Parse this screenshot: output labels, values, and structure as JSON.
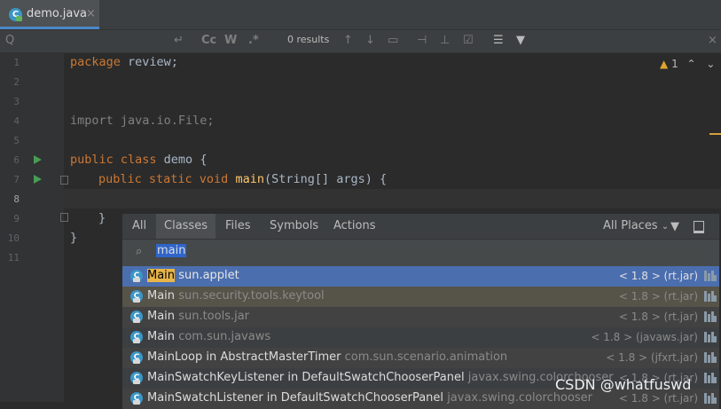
{
  "tab": {
    "title": "demo.java",
    "icon_letter": "C",
    "close": "×"
  },
  "searchbar": {
    "search_icon": "Q",
    "replace_icon": "↵",
    "match_case": "Cc",
    "words": "W",
    "regex": ".*",
    "results": "0 results",
    "close": "×"
  },
  "editor": {
    "line_numbers": [
      "1",
      "2",
      "3",
      "4",
      "5",
      "6",
      "7",
      "8",
      "9",
      "10",
      "11"
    ],
    "lines": {
      "l1_kw": "package",
      "l1_rest": " review;",
      "l4": "import java.io.File;",
      "l6_kw": "public class",
      "l6_rest": " demo {",
      "l7_kw": "public static void",
      "l7_name": " main",
      "l7_rest": "(String[] args) {",
      "l9": "}",
      "l10": "}"
    },
    "warning_count": "1",
    "warning_icon": "▲",
    "nav_up": "⌃",
    "nav_down": "⌄"
  },
  "popup": {
    "tabs": [
      "All",
      "Classes",
      "Files",
      "Symbols",
      "Actions"
    ],
    "selected_tab": "Classes",
    "all_places": "All Places",
    "query": "main",
    "results": [
      {
        "name": "Main",
        "package": "sun.applet",
        "location": "< 1.8 > (rt.jar)"
      },
      {
        "name": "Main",
        "package": "sun.security.tools.keytool",
        "location": "< 1.8 > (rt.jar)"
      },
      {
        "name": "Main",
        "package": "sun.tools.jar",
        "location": "< 1.8 > (rt.jar)"
      },
      {
        "name": "Main",
        "package": "com.sun.javaws",
        "location": "< 1.8 > (javaws.jar)"
      },
      {
        "name": "MainLoop in AbstractMasterTimer",
        "package": "com.sun.scenario.animation",
        "location": "< 1.8 > (jfxrt.jar)"
      },
      {
        "name": "MainSwatchKeyListener in DefaultSwatchChooserPanel",
        "package": "javax.swing.colorchooser",
        "location": "< 1.8 > (rt.jar)"
      },
      {
        "name": "MainSwatchListener in DefaultSwatchChooserPanel",
        "package": "javax.swing.colorchooser",
        "location": "< 1.8 > (rt.jar)"
      }
    ]
  },
  "watermark": "CSDN @whatfuswd",
  "colors": {
    "keyword": "#cc7832",
    "selection": "#4b6eaf",
    "accent": "#4a88c7",
    "run": "#499c54"
  }
}
